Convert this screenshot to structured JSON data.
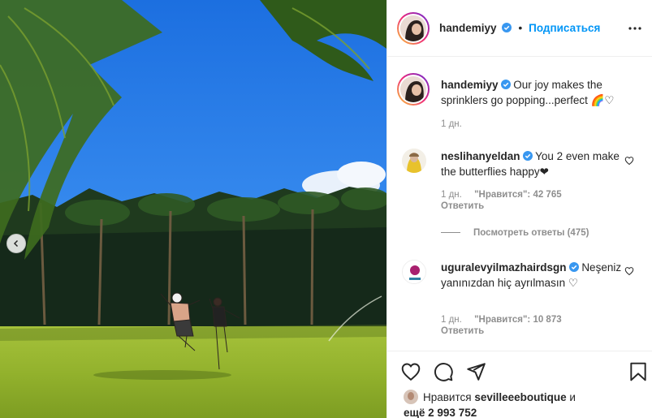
{
  "post_author": {
    "username": "handemiyy",
    "follow_label": "Подписаться",
    "separator": "•"
  },
  "caption": {
    "username": "handemiyy",
    "text": "Our joy makes the sprinklers go popping...perfect 🌈♡",
    "time": "1 дн."
  },
  "comments": [
    {
      "username": "neslihanyeldan",
      "text": "You 2 even make the butterflies happy❤",
      "time": "1 дн.",
      "likes": "\"Нравится\": 42 765",
      "reply_label": "Ответить"
    },
    {
      "username": "uguralevyilmazhairdsgn",
      "text": "Neşeniz yanınızdan hiç ayrılmasın ♡",
      "time": "1 дн.",
      "likes": "\"Нравится\": 10 873",
      "reply_label": "Ответить"
    }
  ],
  "view_replies": "Посмотреть ответы (475)",
  "likes_summary": {
    "prefix": "Нравится",
    "user": "sevilleeeboutique",
    "conj": "и",
    "more": "ещё 2 993 752"
  },
  "colors": {
    "accent": "#0095f6",
    "verified": "#3897f0",
    "muted": "#8e8e8e",
    "heart_red": "#ed4956"
  },
  "icons": {
    "like": "heart-icon",
    "comment": "comment-icon",
    "share": "paper-plane-icon",
    "save": "bookmark-icon",
    "more": "more-dots-icon",
    "prev": "chevron-left-icon"
  }
}
